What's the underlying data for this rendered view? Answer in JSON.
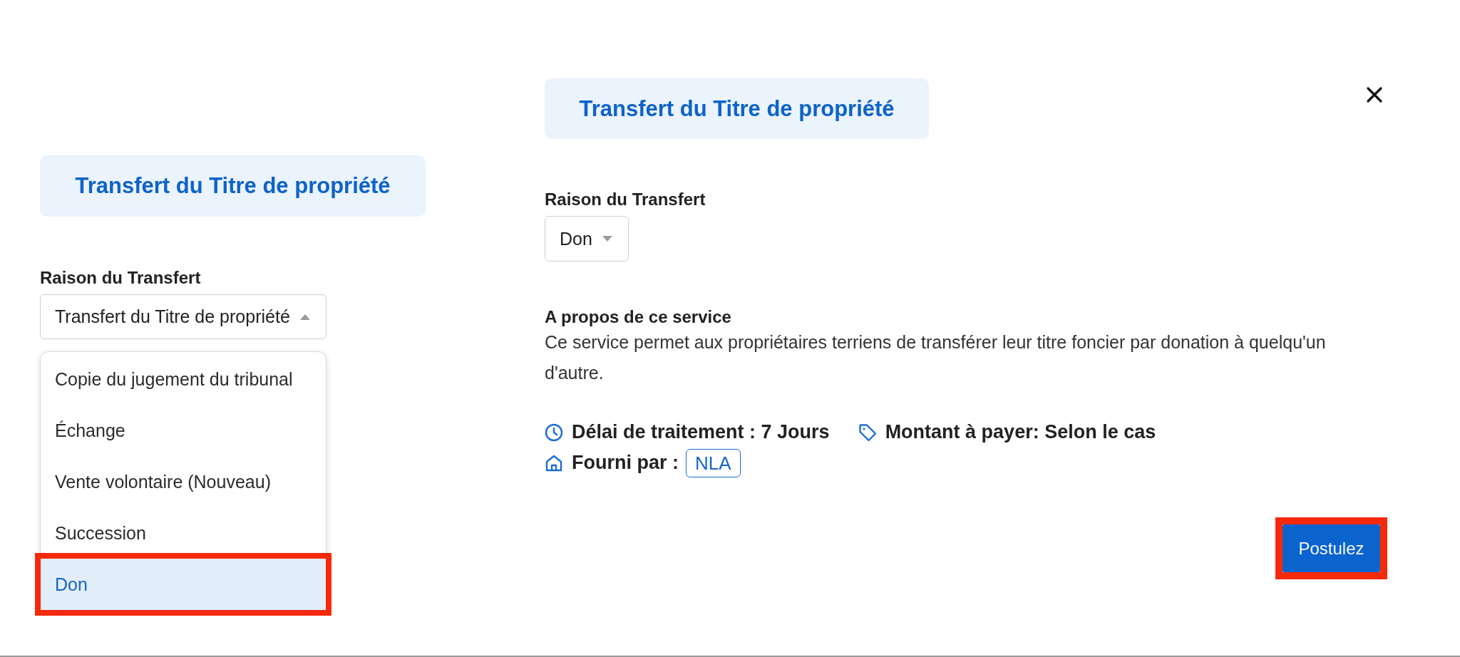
{
  "left_panel": {
    "title": "Transfert du Titre de propriété",
    "field": {
      "label": "Raison du Transfert",
      "value": "Transfert du Titre de propriété",
      "expanded": true,
      "options": [
        {
          "label": "Copie du jugement du tribunal",
          "selected": false,
          "highlighted": false
        },
        {
          "label": "Échange",
          "selected": false,
          "highlighted": false
        },
        {
          "label": "Vente volontaire (Nouveau)",
          "selected": false,
          "highlighted": false
        },
        {
          "label": "Succession",
          "selected": false,
          "highlighted": false
        },
        {
          "label": "Don",
          "selected": true,
          "highlighted": true
        }
      ]
    }
  },
  "right_panel": {
    "title": "Transfert du Titre de propriété",
    "field": {
      "label": "Raison du Transfert",
      "value": "Don",
      "expanded": false
    },
    "about": {
      "heading": "A propos de ce service",
      "text": "Ce service permet aux propriétaires terriens de transférer leur titre foncier par donation à quelqu'un d'autre."
    },
    "detail_rows": [
      {
        "items": [
          {
            "kind": "duration",
            "text": "Délai de traitement : 7 Jours"
          },
          {
            "kind": "price",
            "text": "Montant à payer: Selon le cas"
          }
        ]
      },
      {
        "items": [
          {
            "kind": "provider",
            "text": "Fourni par :",
            "badge": "NLA"
          }
        ]
      }
    ],
    "apply_button": {
      "label": "Postulez",
      "highlighted": true
    }
  }
}
